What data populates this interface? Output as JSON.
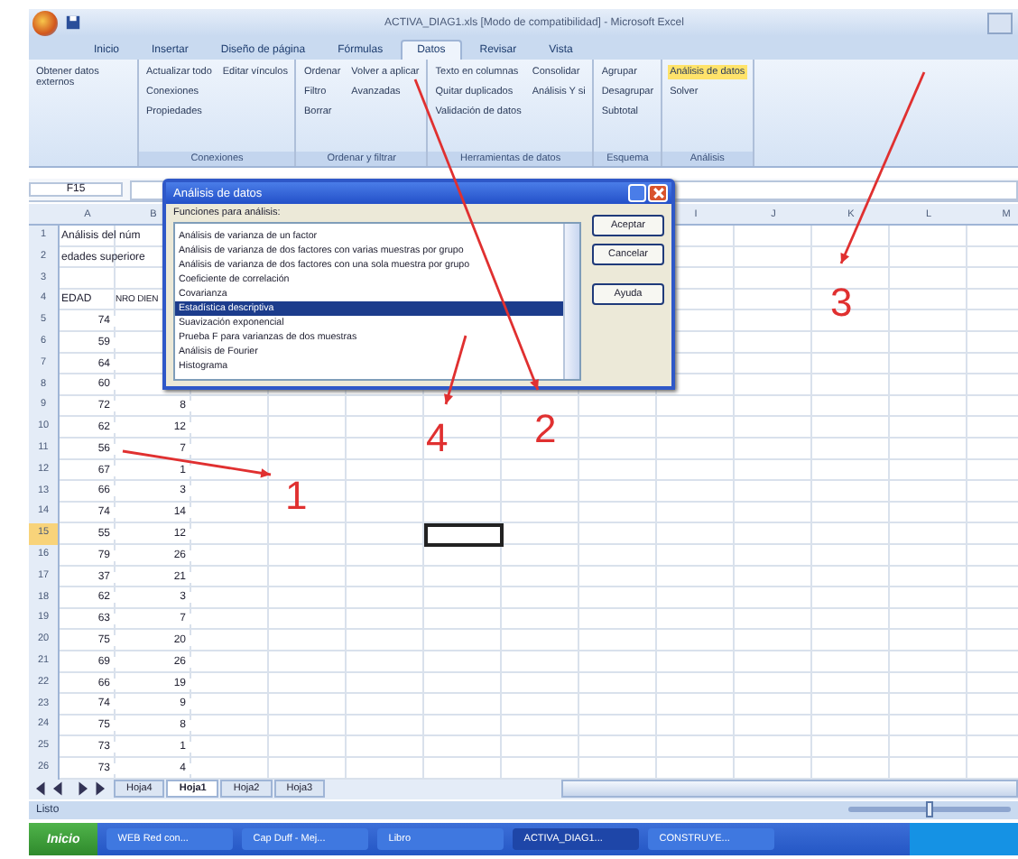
{
  "window": {
    "title": "ACTIVA_DIAG1.xls [Modo de compatibilidad] - Microsoft Excel"
  },
  "tabs": [
    {
      "label": "Inicio",
      "selected": false
    },
    {
      "label": "Insertar",
      "selected": false
    },
    {
      "label": "Diseño de página",
      "selected": false
    },
    {
      "label": "Fórmulas",
      "selected": false
    },
    {
      "label": "Datos",
      "selected": true
    },
    {
      "label": "Revisar",
      "selected": false
    },
    {
      "label": "Vista",
      "selected": false
    }
  ],
  "ribbon_groups": [
    {
      "buttons": [
        {
          "label": "Obtener datos externos",
          "highlighted": false
        }
      ]
    },
    {
      "label": "Conexiones",
      "buttons": [
        {
          "label": "Actualizar todo",
          "highlighted": false
        },
        {
          "label": "Conexiones",
          "highlighted": false
        },
        {
          "label": "Propiedades",
          "highlighted": false
        },
        {
          "label": "Editar vínculos",
          "highlighted": false
        }
      ]
    },
    {
      "label": "Ordenar y filtrar",
      "buttons": [
        {
          "label": "Ordenar",
          "highlighted": false
        },
        {
          "label": "Filtro",
          "highlighted": false
        },
        {
          "label": "Borrar",
          "highlighted": false
        },
        {
          "label": "Volver a aplicar",
          "highlighted": false
        },
        {
          "label": "Avanzadas",
          "highlighted": false
        }
      ]
    },
    {
      "label": "Herramientas de datos",
      "buttons": [
        {
          "label": "Texto en columnas",
          "highlighted": false
        },
        {
          "label": "Quitar duplicados",
          "highlighted": false
        },
        {
          "label": "Validación de datos",
          "highlighted": false
        },
        {
          "label": "Consolidar",
          "highlighted": false
        },
        {
          "label": "Análisis Y si",
          "highlighted": false
        }
      ]
    },
    {
      "label": "Esquema",
      "buttons": [
        {
          "label": "Agrupar",
          "highlighted": false
        },
        {
          "label": "Desagrupar",
          "highlighted": false
        },
        {
          "label": "Subtotal",
          "highlighted": false
        }
      ]
    },
    {
      "label": "Análisis",
      "buttons": [
        {
          "label": "Análisis de datos",
          "highlighted": true
        },
        {
          "label": "Solver",
          "highlighted": false
        }
      ]
    }
  ],
  "name_box": "F15",
  "columns": [
    "A",
    "B",
    "I",
    "J",
    "K",
    "L",
    "M"
  ],
  "rows": [
    {
      "n": "1",
      "active": false,
      "text": "Análisis del núm"
    },
    {
      "n": "2",
      "active": false,
      "text": "edades superiore"
    },
    {
      "n": "3",
      "active": false
    },
    {
      "n": "4",
      "active": false,
      "headings": [
        "EDAD",
        "NRO DIEN"
      ]
    },
    {
      "n": "5",
      "active": false,
      "a": "74"
    },
    {
      "n": "6",
      "active": false,
      "a": "59"
    },
    {
      "n": "7",
      "active": false,
      "a": "64"
    },
    {
      "n": "8",
      "active": false,
      "a": "60"
    },
    {
      "n": "9",
      "active": false,
      "a": "72",
      "b": "8"
    },
    {
      "n": "10",
      "active": false,
      "a": "62",
      "b": "12"
    },
    {
      "n": "11",
      "active": false,
      "a": "56",
      "b": "7"
    },
    {
      "n": "12",
      "active": false,
      "a": "67",
      "b": "1"
    },
    {
      "n": "13",
      "active": false,
      "a": "66",
      "b": "3"
    },
    {
      "n": "14",
      "active": false,
      "a": "74",
      "b": "14"
    },
    {
      "n": "15",
      "active": true,
      "a": "55",
      "b": "12"
    },
    {
      "n": "16",
      "active": false,
      "a": "79",
      "b": "26"
    },
    {
      "n": "17",
      "active": false,
      "a": "37",
      "b": "21"
    },
    {
      "n": "18",
      "active": false,
      "a": "62",
      "b": "3"
    },
    {
      "n": "19",
      "active": false,
      "a": "63",
      "b": "7"
    },
    {
      "n": "20",
      "active": false,
      "a": "75",
      "b": "20"
    },
    {
      "n": "21",
      "active": false,
      "a": "69",
      "b": "26"
    },
    {
      "n": "22",
      "active": false,
      "a": "66",
      "b": "19"
    },
    {
      "n": "23",
      "active": false,
      "a": "74",
      "b": "9"
    },
    {
      "n": "24",
      "active": false,
      "a": "75",
      "b": "8"
    },
    {
      "n": "25",
      "active": false,
      "a": "73",
      "b": "1"
    },
    {
      "n": "26",
      "active": false,
      "a": "73",
      "b": "4"
    }
  ],
  "dialog": {
    "title": "Análisis de datos",
    "list_label": "Funciones para análisis:",
    "items": [
      {
        "label": "Análisis de varianza de un factor",
        "selected": false
      },
      {
        "label": "Análisis de varianza de dos factores con varias muestras por grupo",
        "selected": false
      },
      {
        "label": "Análisis de varianza de dos factores con una sola muestra por grupo",
        "selected": false
      },
      {
        "label": "Coeficiente de correlación",
        "selected": false
      },
      {
        "label": "Covarianza",
        "selected": false
      },
      {
        "label": "Estadística descriptiva",
        "selected": true
      },
      {
        "label": "Suavización exponencial",
        "selected": false
      },
      {
        "label": "Prueba F para varianzas de dos muestras",
        "selected": false
      },
      {
        "label": "Análisis de Fourier",
        "selected": false
      },
      {
        "label": "Histograma",
        "selected": false
      }
    ],
    "buttons": [
      "Aceptar",
      "Cancelar",
      "Ayuda"
    ]
  },
  "sheet_tabs": [
    {
      "label": "Hoja4",
      "selected": false
    },
    {
      "label": "Hoja1",
      "selected": true
    },
    {
      "label": "Hoja2",
      "selected": false
    },
    {
      "label": "Hoja3",
      "selected": false
    }
  ],
  "status_bar": {
    "text": "Listo",
    "zoom": {
      "level": 0.5
    }
  },
  "taskbar": {
    "start": "Inicio",
    "items": [
      {
        "label": "WEB Red con...",
        "active": false
      },
      {
        "label": "Cap Duff - Mej...",
        "active": false
      },
      {
        "label": "Libro",
        "active": false
      },
      {
        "label": "ACTIVA_DIAG1...",
        "active": true
      },
      {
        "label": "CONSTRUYE...",
        "active": false
      }
    ]
  },
  "annotations": [
    "1",
    "2",
    "3",
    "4"
  ]
}
